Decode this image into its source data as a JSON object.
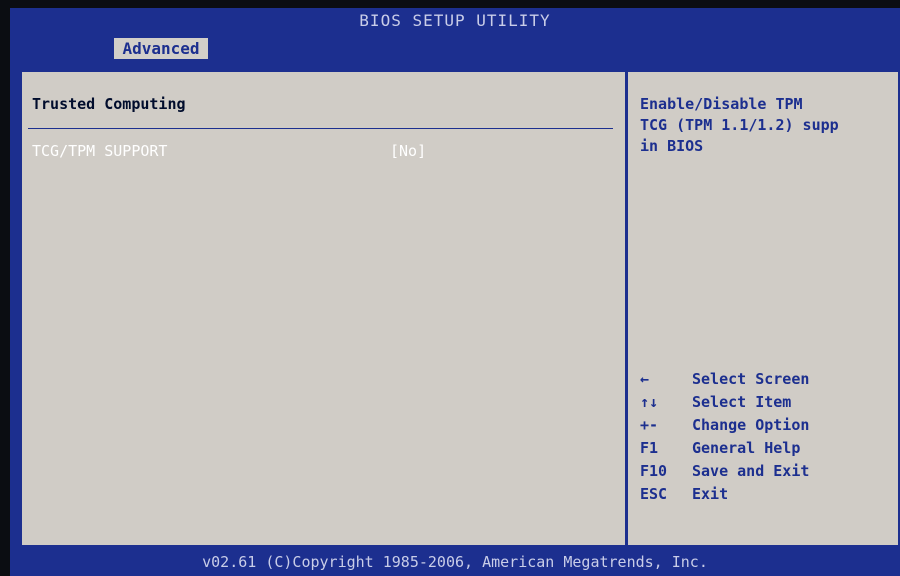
{
  "title": "BIOS SETUP UTILITY",
  "tabs": [
    {
      "label": "Advanced",
      "active": true
    }
  ],
  "section": {
    "title": "Trusted Computing",
    "settings": [
      {
        "label": "TCG/TPM SUPPORT",
        "value": "[No]"
      }
    ]
  },
  "help": {
    "lines": [
      "Enable/Disable TPM",
      "TCG (TPM 1.1/1.2) supp",
      "in BIOS"
    ]
  },
  "keys": [
    {
      "key": "←",
      "desc": "Select Screen"
    },
    {
      "key": "↑↓",
      "desc": "Select Item"
    },
    {
      "key": "+-",
      "desc": "Change Option"
    },
    {
      "key": "F1",
      "desc": "General Help"
    },
    {
      "key": "F10",
      "desc": "Save and Exit"
    },
    {
      "key": "ESC",
      "desc": "Exit"
    }
  ],
  "footer": "v02.61 (C)Copyright 1985-2006, American Megatrends, Inc.",
  "colors": {
    "background": "#1c2f8f",
    "panel": "#d0ccc6",
    "highlight_text": "#ffffff",
    "accent_text": "#1c2f8f"
  }
}
